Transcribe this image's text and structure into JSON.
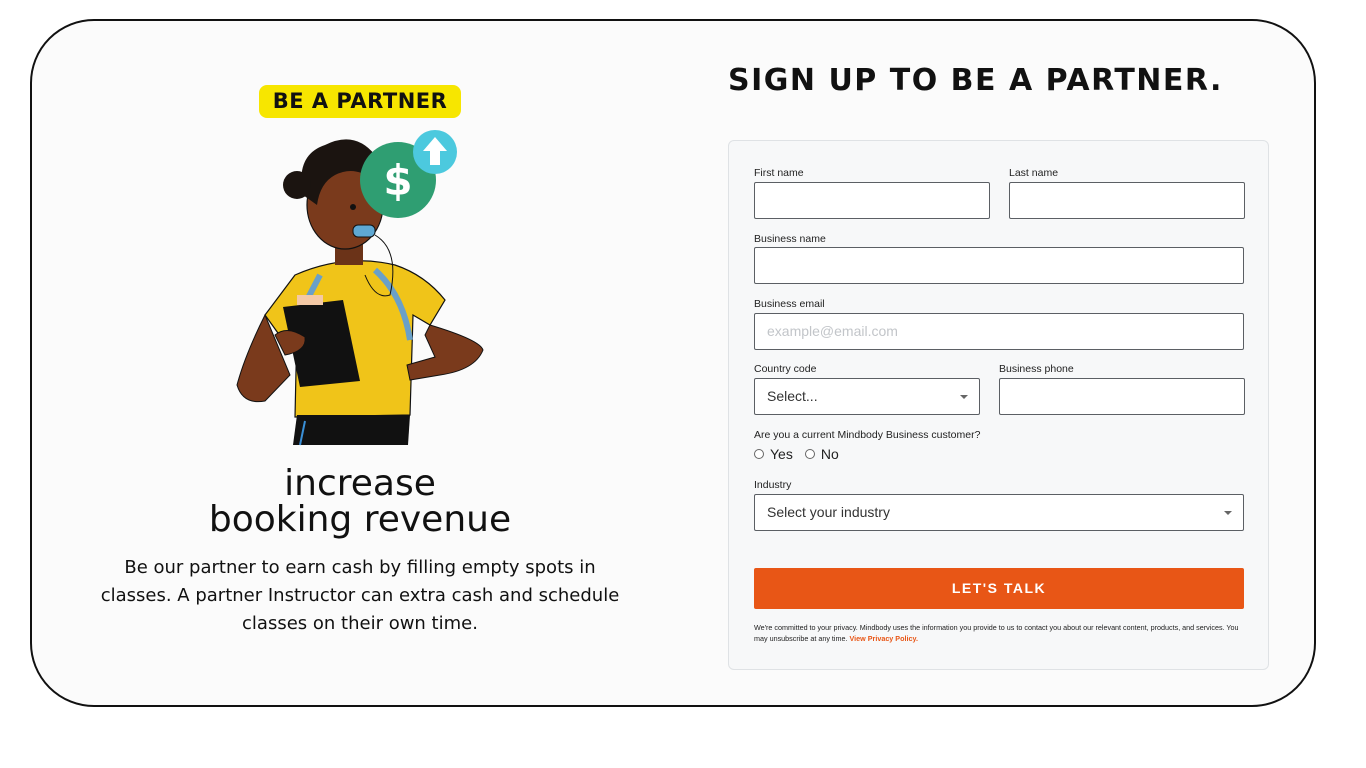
{
  "left": {
    "badge": "BE A PARTNER",
    "headline_line1": "increase",
    "headline_line2": "booking revenue",
    "description": "Be our partner to earn cash by filling empty spots in classes. A partner Instructor can extra cash and schedule classes on their own time."
  },
  "form": {
    "title": "SIGN UP TO BE A PARTNER.",
    "first_name_label": "First name",
    "first_name_value": "",
    "last_name_label": "Last name",
    "last_name_value": "",
    "business_name_label": "Business name",
    "business_name_value": "",
    "business_email_label": "Business email",
    "business_email_placeholder": "example@email.com",
    "country_code_label": "Country code",
    "country_code_selected": "Select...",
    "business_phone_label": "Business phone",
    "business_phone_value": "",
    "customer_question": "Are you a current Mindbody Business customer?",
    "radio_yes": "Yes",
    "radio_no": "No",
    "industry_label": "Industry",
    "industry_selected": "Select your industry",
    "submit_label": "LET'S TALK",
    "privacy_text": "We're committed to your privacy. Mindbody uses the information you provide to us to contact you about our relevant content, products, and services. You may unsubscribe at any time.",
    "privacy_link": "View Privacy Policy."
  },
  "colors": {
    "badge": "#f7e600",
    "cta": "#e85616",
    "coin": "#2f9e72",
    "arrow_badge": "#4cc9de",
    "shirt": "#f0c419"
  },
  "icons": [
    "dollar-coin-icon",
    "up-arrow-icon",
    "chevron-down-icon"
  ]
}
